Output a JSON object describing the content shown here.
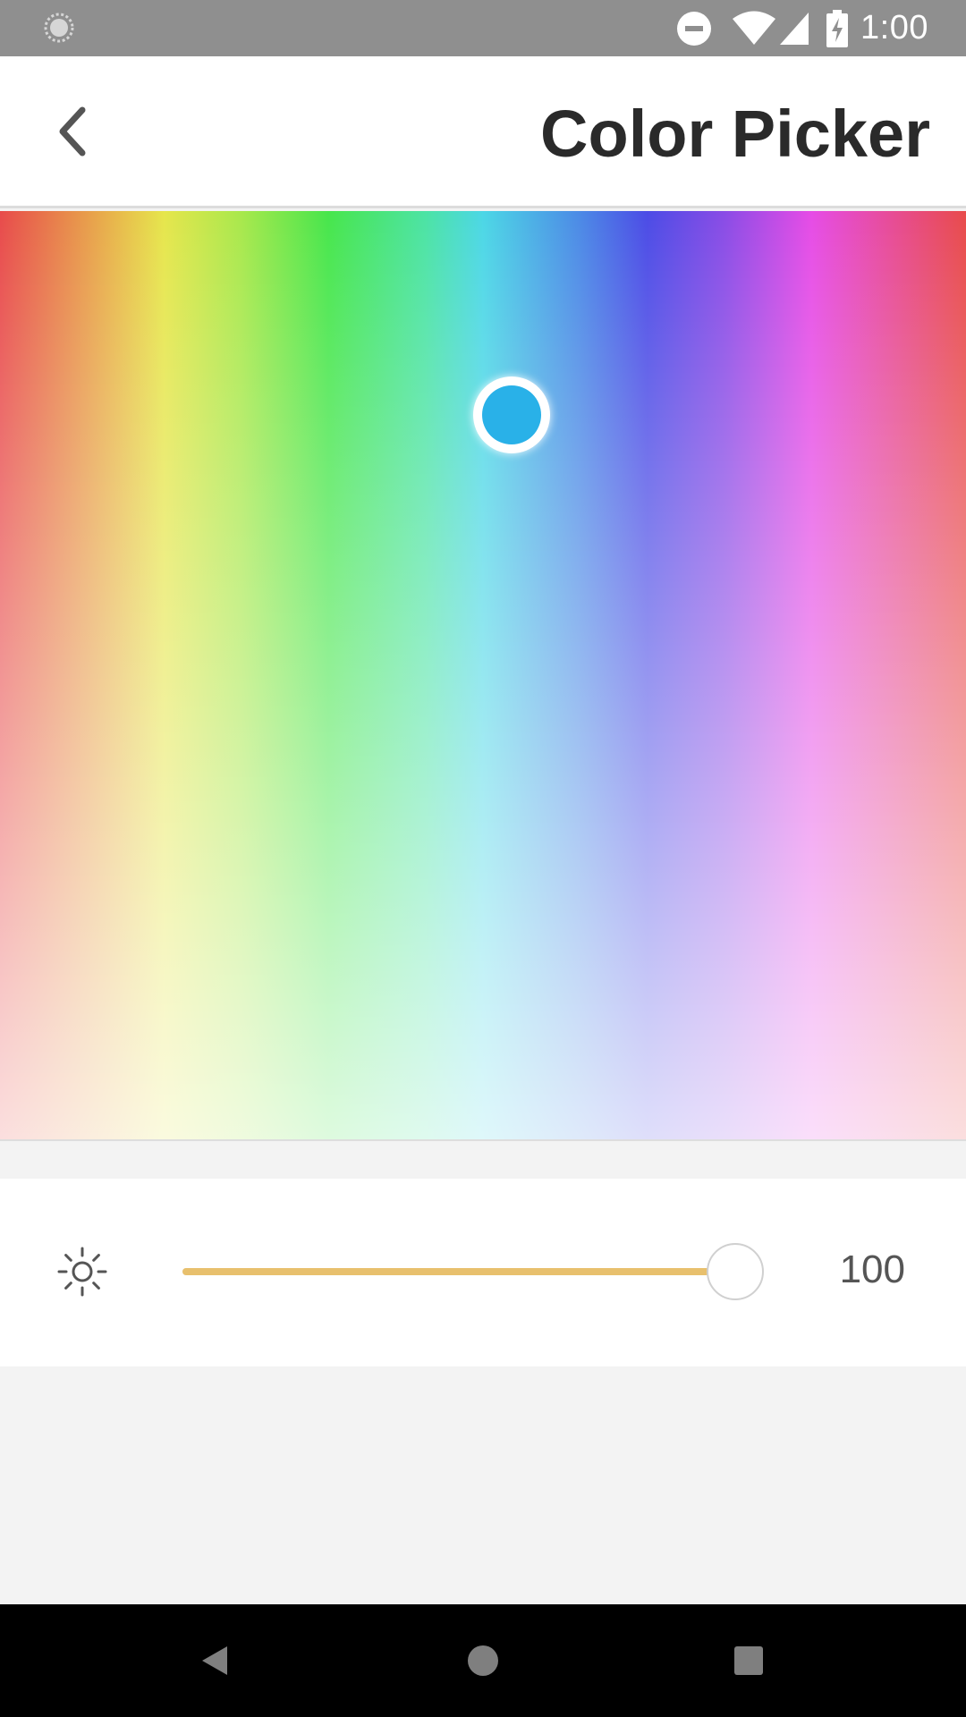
{
  "status_bar": {
    "time": "1:00",
    "icons": [
      "loading-icon",
      "do-not-disturb-icon",
      "wifi-icon",
      "cell-signal-icon",
      "battery-charging-icon"
    ]
  },
  "app_bar": {
    "back_icon": "chevron-left-icon",
    "title": "Color Picker"
  },
  "color_picker": {
    "selected_color": "#29b1e8",
    "handle_fraction": {
      "hue": 0.53,
      "saturation": 0.78
    }
  },
  "brightness": {
    "icon": "sun-icon",
    "value": "100",
    "fraction": 1.0,
    "track_fill_color": "#e8c06d"
  },
  "nav_bar": {
    "icons": [
      "back-triangle-icon",
      "home-circle-icon",
      "recents-square-icon"
    ]
  }
}
